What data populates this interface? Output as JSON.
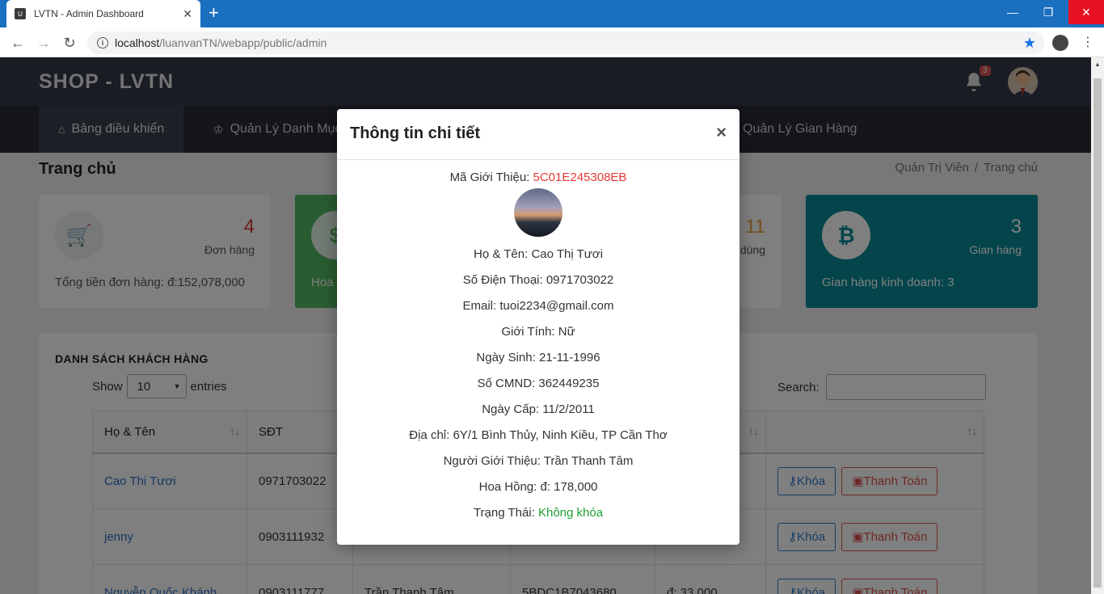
{
  "browser": {
    "tab_title": "LVTN - Admin Dashboard",
    "favicon_text": "U",
    "url_host": "localhost",
    "url_path": "/luanvanTN/webapp/public/admin"
  },
  "header": {
    "brand": "SHOP - LVTN",
    "notification_count": "3"
  },
  "nav": {
    "items": [
      {
        "label": "Bảng điều khiển"
      },
      {
        "label": "Quản Lý Danh Mục"
      },
      {
        "label": "Quản Lý Gian Hàng"
      }
    ]
  },
  "page": {
    "title": "Trang chủ",
    "breadcrumb_root": "Quản Trị Viên",
    "breadcrumb_sep": "/",
    "breadcrumb_current": "Trang chủ"
  },
  "stats": [
    {
      "value": "4",
      "label": "Đơn hàng",
      "footer": "Tổng tiền đơn hàng: đ:152,078,000"
    },
    {
      "value": "",
      "label": "",
      "footer": "Hoa"
    },
    {
      "value": "11",
      "label": "dùng",
      "footer": ""
    },
    {
      "value": "3",
      "label": "Gian hàng",
      "footer": "Gian hàng kinh doanh: 3"
    }
  ],
  "customers": {
    "title": "DANH SÁCH KHÁCH HÀNG",
    "show_label": "Show",
    "entries_value": "10",
    "entries_label": "entries",
    "search_label": "Search:",
    "columns": [
      "Họ & Tên",
      "SĐT",
      "",
      "",
      "",
      ""
    ],
    "rows": [
      {
        "name": "Cao Thi Tươi",
        "phone": "0971703022",
        "ref": "",
        "code": "",
        "money": ""
      },
      {
        "name": "jenny",
        "phone": "0903111932",
        "ref": "",
        "code": "",
        "money": ""
      },
      {
        "name": "Nguyễn Quốc Khánh",
        "phone": "0903111777",
        "ref": "Trần Thanh Tâm",
        "code": "5BDC1B7043680",
        "money": "đ: 33,000"
      }
    ],
    "btn_lock": "Khóa",
    "btn_pay": "Thanh Toán"
  },
  "modal": {
    "title": "Thông tin chi tiết",
    "close": "×",
    "ref_code_label": "Mã Giới Thiệu:",
    "ref_code": "5C01E245308EB",
    "name": "Họ & Tên: Cao Thị Tươi",
    "phone": "Số Điện Thoại: 0971703022",
    "email": "Email: tuoi2234@gmail.com",
    "gender": "Giới Tính: Nữ",
    "dob": "Ngày Sinh: 21-11-1996",
    "id_no": "Số CMND: 362449235",
    "issue_date": "Ngày Cấp: 11/2/2011",
    "address": "Địa chỉ: 6Y/1 Bình Thủy, Ninh Kiều, TP Cần Thơ",
    "referrer": "Người Giới Thiệu: Trần Thanh Tâm",
    "commission": "Hoa Hồng: đ: 178,000",
    "status_label": "Trạng Thái:",
    "status_value": "Không khóa",
    "colors": {
      "code": "#e53935",
      "status": "#1e9e36"
    }
  }
}
